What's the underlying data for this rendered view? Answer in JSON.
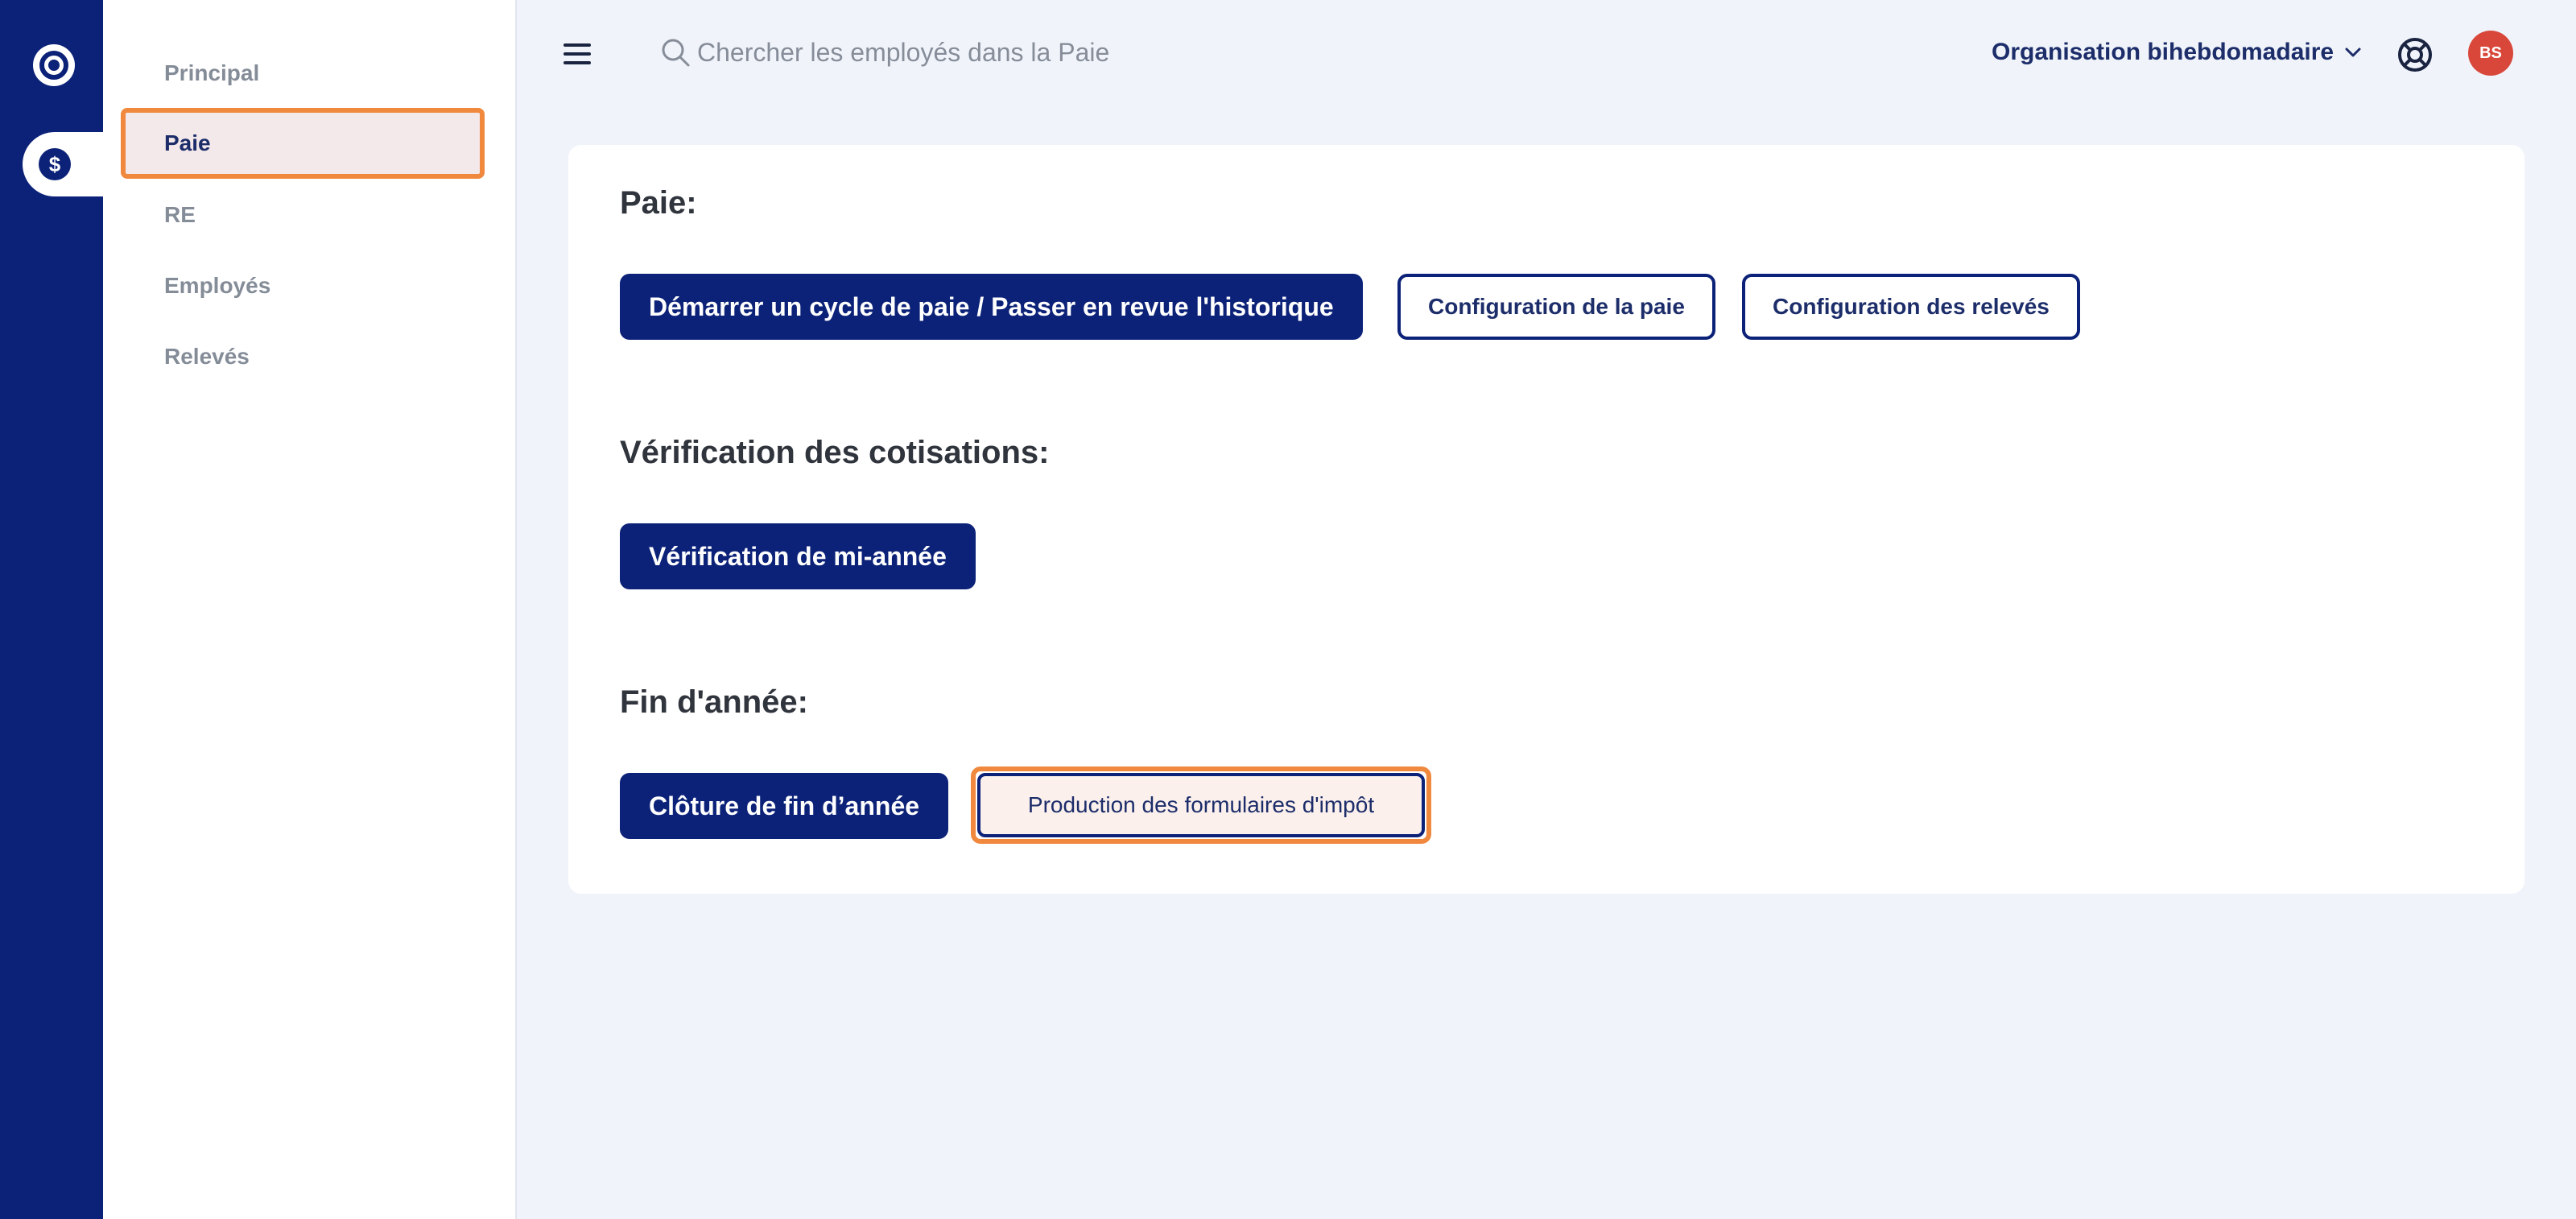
{
  "colors": {
    "brand": "#0c2278",
    "highlight": "#f0883e",
    "avatar": "#d9473a"
  },
  "rail": {
    "logo_icon": "ring-logo-icon",
    "active_icon": "dollar-icon",
    "active_icon_glyph": "$"
  },
  "subnav": {
    "items": [
      {
        "label": "Principal"
      },
      {
        "label": "Paie"
      },
      {
        "label": "RE"
      },
      {
        "label": "Employés"
      },
      {
        "label": "Relevés"
      }
    ],
    "active_index": 1
  },
  "topbar": {
    "menu_icon": "hamburger-icon",
    "search": {
      "placeholder": "Chercher les employés dans la Paie",
      "icon": "search-icon"
    },
    "organization": {
      "label": "Organisation bihebdomadaire",
      "icon": "chevron-down-icon"
    },
    "help_icon": "lifebuoy-icon",
    "avatar_initials": "BS"
  },
  "main": {
    "sections": [
      {
        "title": "Paie:",
        "buttons": [
          {
            "label": "Démarrer un cycle de paie / Passer en revue l'historique",
            "style": "primary"
          },
          {
            "label": "Configuration de la paie",
            "style": "outline"
          },
          {
            "label": "Configuration des relevés",
            "style": "outline"
          }
        ]
      },
      {
        "title": "Vérification des cotisations:",
        "buttons": [
          {
            "label": "Vérification de mi-année",
            "style": "primary"
          }
        ]
      },
      {
        "title": "Fin d'année:",
        "buttons": [
          {
            "label": "Clôture de fin d’année",
            "style": "primary"
          },
          {
            "label": "Production des formulaires d'impôt",
            "style": "outline-highlighted"
          }
        ]
      }
    ]
  }
}
